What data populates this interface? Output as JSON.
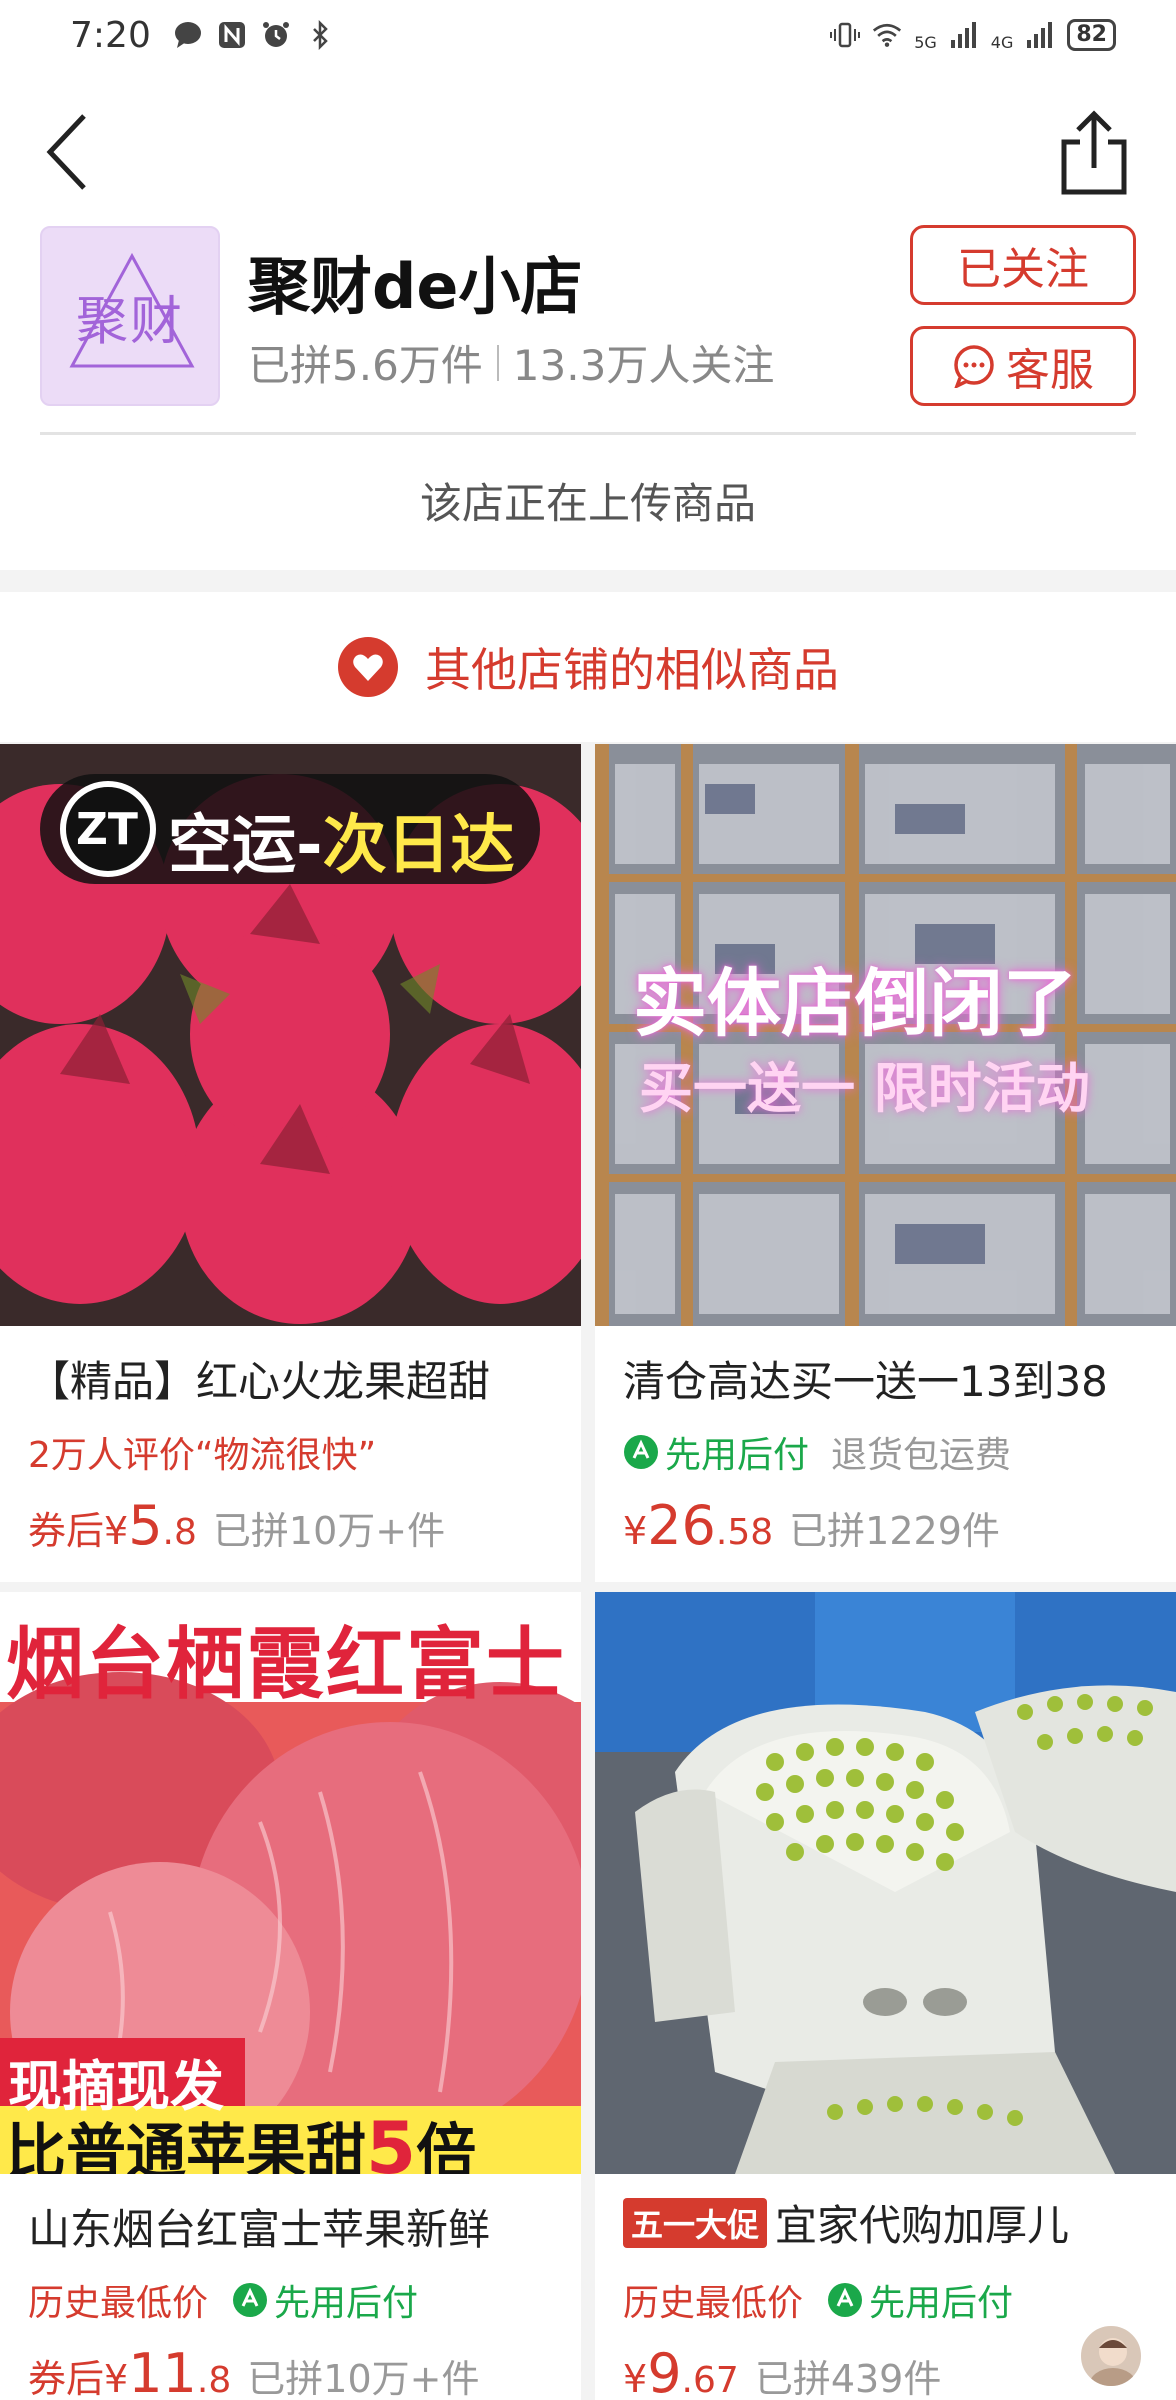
{
  "status_bar": {
    "time": "7:20",
    "battery": "82",
    "net_label_1": "5G",
    "net_label_2": "4G"
  },
  "shop": {
    "logo_text": "聚财",
    "name": "聚财de小店",
    "sold": "已拼5.6万件",
    "followers": "13.3万人关注",
    "follow_label": "已关注",
    "service_label": "客服",
    "upload_notice": "该店正在上传商品"
  },
  "similar": {
    "title": "其他店铺的相似商品"
  },
  "products": [
    {
      "title": "【精品】红心火龙果超甜",
      "tag1": "2万人评价“物流很快”",
      "price_prefix": "券后¥",
      "price_int": "5",
      "price_dec": ".8",
      "sold": "已拼10万+件",
      "image_text_1": "空运-",
      "image_text_2": "次日达",
      "image_logo": "ZT"
    },
    {
      "title": "清仓高达买一送一13到38",
      "tag_green": "先用后付",
      "tag_gray": "退货包运费",
      "price_prefix": "¥",
      "price_int": "26",
      "price_dec": ".58",
      "sold": "已拼1229件",
      "image_text_1": "实体店倒闭了",
      "image_text_2": "买一送一 限时活动"
    },
    {
      "title": "山东烟台红富士苹果新鲜",
      "tag1": "历史最低价",
      "tag_green": "先用后付",
      "price_prefix": "券后¥",
      "price_int": "11",
      "price_dec": ".8",
      "sold": "已拼10万+件",
      "image_text_1": "烟台栖霞红富士",
      "image_text_2": "现摘现发",
      "image_text_3": "比普通苹果甜",
      "image_text_4": "5",
      "image_text_5": "倍"
    },
    {
      "promo": "五一大促",
      "title": "宜家代购加厚儿",
      "tag1": "历史最低价",
      "tag_green": "先用后付",
      "price_prefix": "¥",
      "price_int": "9",
      "price_dec": ".67",
      "sold": "已拼439件"
    }
  ]
}
